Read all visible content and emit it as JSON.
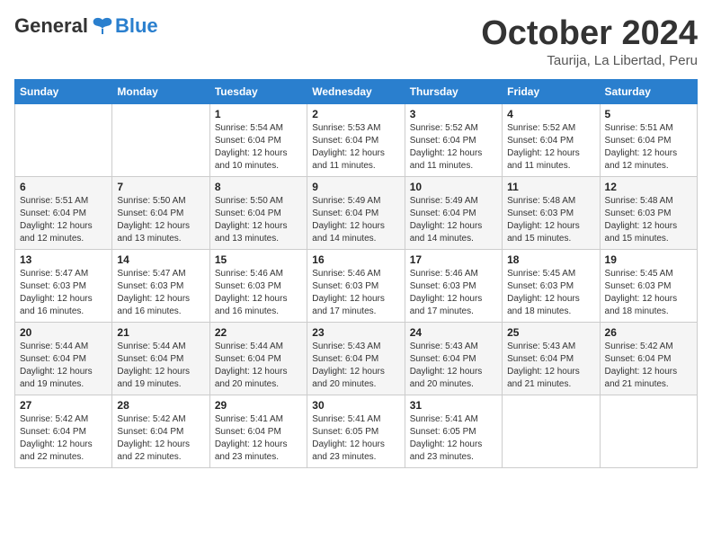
{
  "header": {
    "logo_general": "General",
    "logo_blue": "Blue",
    "title": "October 2024",
    "location": "Taurija, La Libertad, Peru"
  },
  "days_of_week": [
    "Sunday",
    "Monday",
    "Tuesday",
    "Wednesday",
    "Thursday",
    "Friday",
    "Saturday"
  ],
  "weeks": [
    [
      {
        "num": "",
        "detail": ""
      },
      {
        "num": "",
        "detail": ""
      },
      {
        "num": "1",
        "detail": "Sunrise: 5:54 AM\nSunset: 6:04 PM\nDaylight: 12 hours\nand 10 minutes."
      },
      {
        "num": "2",
        "detail": "Sunrise: 5:53 AM\nSunset: 6:04 PM\nDaylight: 12 hours\nand 11 minutes."
      },
      {
        "num": "3",
        "detail": "Sunrise: 5:52 AM\nSunset: 6:04 PM\nDaylight: 12 hours\nand 11 minutes."
      },
      {
        "num": "4",
        "detail": "Sunrise: 5:52 AM\nSunset: 6:04 PM\nDaylight: 12 hours\nand 11 minutes."
      },
      {
        "num": "5",
        "detail": "Sunrise: 5:51 AM\nSunset: 6:04 PM\nDaylight: 12 hours\nand 12 minutes."
      }
    ],
    [
      {
        "num": "6",
        "detail": "Sunrise: 5:51 AM\nSunset: 6:04 PM\nDaylight: 12 hours\nand 12 minutes."
      },
      {
        "num": "7",
        "detail": "Sunrise: 5:50 AM\nSunset: 6:04 PM\nDaylight: 12 hours\nand 13 minutes."
      },
      {
        "num": "8",
        "detail": "Sunrise: 5:50 AM\nSunset: 6:04 PM\nDaylight: 12 hours\nand 13 minutes."
      },
      {
        "num": "9",
        "detail": "Sunrise: 5:49 AM\nSunset: 6:04 PM\nDaylight: 12 hours\nand 14 minutes."
      },
      {
        "num": "10",
        "detail": "Sunrise: 5:49 AM\nSunset: 6:04 PM\nDaylight: 12 hours\nand 14 minutes."
      },
      {
        "num": "11",
        "detail": "Sunrise: 5:48 AM\nSunset: 6:03 PM\nDaylight: 12 hours\nand 15 minutes."
      },
      {
        "num": "12",
        "detail": "Sunrise: 5:48 AM\nSunset: 6:03 PM\nDaylight: 12 hours\nand 15 minutes."
      }
    ],
    [
      {
        "num": "13",
        "detail": "Sunrise: 5:47 AM\nSunset: 6:03 PM\nDaylight: 12 hours\nand 16 minutes."
      },
      {
        "num": "14",
        "detail": "Sunrise: 5:47 AM\nSunset: 6:03 PM\nDaylight: 12 hours\nand 16 minutes."
      },
      {
        "num": "15",
        "detail": "Sunrise: 5:46 AM\nSunset: 6:03 PM\nDaylight: 12 hours\nand 16 minutes."
      },
      {
        "num": "16",
        "detail": "Sunrise: 5:46 AM\nSunset: 6:03 PM\nDaylight: 12 hours\nand 17 minutes."
      },
      {
        "num": "17",
        "detail": "Sunrise: 5:46 AM\nSunset: 6:03 PM\nDaylight: 12 hours\nand 17 minutes."
      },
      {
        "num": "18",
        "detail": "Sunrise: 5:45 AM\nSunset: 6:03 PM\nDaylight: 12 hours\nand 18 minutes."
      },
      {
        "num": "19",
        "detail": "Sunrise: 5:45 AM\nSunset: 6:03 PM\nDaylight: 12 hours\nand 18 minutes."
      }
    ],
    [
      {
        "num": "20",
        "detail": "Sunrise: 5:44 AM\nSunset: 6:04 PM\nDaylight: 12 hours\nand 19 minutes."
      },
      {
        "num": "21",
        "detail": "Sunrise: 5:44 AM\nSunset: 6:04 PM\nDaylight: 12 hours\nand 19 minutes."
      },
      {
        "num": "22",
        "detail": "Sunrise: 5:44 AM\nSunset: 6:04 PM\nDaylight: 12 hours\nand 20 minutes."
      },
      {
        "num": "23",
        "detail": "Sunrise: 5:43 AM\nSunset: 6:04 PM\nDaylight: 12 hours\nand 20 minutes."
      },
      {
        "num": "24",
        "detail": "Sunrise: 5:43 AM\nSunset: 6:04 PM\nDaylight: 12 hours\nand 20 minutes."
      },
      {
        "num": "25",
        "detail": "Sunrise: 5:43 AM\nSunset: 6:04 PM\nDaylight: 12 hours\nand 21 minutes."
      },
      {
        "num": "26",
        "detail": "Sunrise: 5:42 AM\nSunset: 6:04 PM\nDaylight: 12 hours\nand 21 minutes."
      }
    ],
    [
      {
        "num": "27",
        "detail": "Sunrise: 5:42 AM\nSunset: 6:04 PM\nDaylight: 12 hours\nand 22 minutes."
      },
      {
        "num": "28",
        "detail": "Sunrise: 5:42 AM\nSunset: 6:04 PM\nDaylight: 12 hours\nand 22 minutes."
      },
      {
        "num": "29",
        "detail": "Sunrise: 5:41 AM\nSunset: 6:04 PM\nDaylight: 12 hours\nand 23 minutes."
      },
      {
        "num": "30",
        "detail": "Sunrise: 5:41 AM\nSunset: 6:05 PM\nDaylight: 12 hours\nand 23 minutes."
      },
      {
        "num": "31",
        "detail": "Sunrise: 5:41 AM\nSunset: 6:05 PM\nDaylight: 12 hours\nand 23 minutes."
      },
      {
        "num": "",
        "detail": ""
      },
      {
        "num": "",
        "detail": ""
      }
    ]
  ]
}
